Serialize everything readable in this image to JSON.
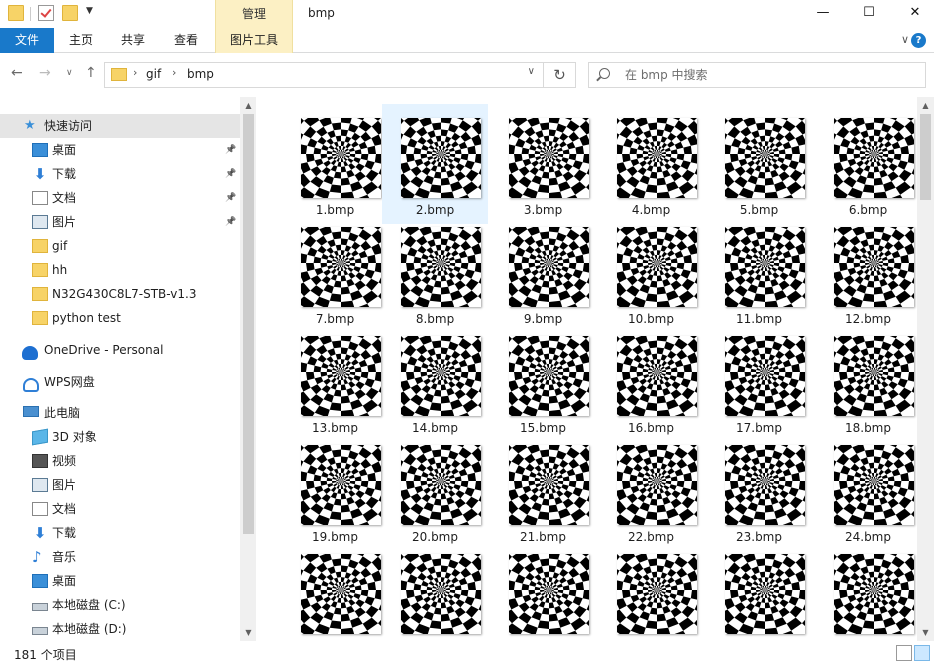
{
  "window": {
    "title": "bmp",
    "contextual_tab_group": "管理",
    "minimize_glyph": "—",
    "maximize_glyph": "☐",
    "close_glyph": "✕"
  },
  "ribbon": {
    "tabs": [
      "文件",
      "主页",
      "共享",
      "查看",
      "图片工具"
    ],
    "collapse_glyph": "∨",
    "help_glyph": "?"
  },
  "address": {
    "breadcrumb": [
      "gif",
      "bmp"
    ],
    "search_placeholder": "在 bmp 中搜索"
  },
  "sidebar": {
    "quick_access": "快速访问",
    "quick_items": [
      {
        "label": "桌面",
        "icon": "desktop-icon",
        "pinned": true
      },
      {
        "label": "下载",
        "icon": "download-icon",
        "pinned": true
      },
      {
        "label": "文档",
        "icon": "document-icon",
        "pinned": true
      },
      {
        "label": "图片",
        "icon": "pictures-icon",
        "pinned": true
      },
      {
        "label": "gif",
        "icon": "folder-icon",
        "pinned": false
      },
      {
        "label": "hh",
        "icon": "folder-icon",
        "pinned": false
      },
      {
        "label": "N32G430C8L7-STB-v1.3",
        "icon": "folder-icon",
        "pinned": false
      },
      {
        "label": "python test",
        "icon": "folder-icon",
        "pinned": false
      }
    ],
    "onedrive": "OneDrive - Personal",
    "wps": "WPS网盘",
    "this_pc": "此电脑",
    "pc_items": [
      {
        "label": "3D 对象",
        "icon": "3d-objects-icon"
      },
      {
        "label": "视频",
        "icon": "videos-icon"
      },
      {
        "label": "图片",
        "icon": "pictures-icon"
      },
      {
        "label": "文档",
        "icon": "document-icon"
      },
      {
        "label": "下载",
        "icon": "download-icon"
      },
      {
        "label": "音乐",
        "icon": "music-icon"
      },
      {
        "label": "桌面",
        "icon": "desktop-icon"
      },
      {
        "label": "本地磁盘 (C:)",
        "icon": "drive-c-icon"
      },
      {
        "label": "本地磁盘 (D:)",
        "icon": "drive-d-icon"
      }
    ]
  },
  "files": [
    "1.bmp",
    "2.bmp",
    "3.bmp",
    "4.bmp",
    "5.bmp",
    "6.bmp",
    "7.bmp",
    "8.bmp",
    "9.bmp",
    "10.bmp",
    "11.bmp",
    "12.bmp",
    "13.bmp",
    "14.bmp",
    "15.bmp",
    "16.bmp",
    "17.bmp",
    "18.bmp",
    "19.bmp",
    "20.bmp",
    "21.bmp",
    "22.bmp",
    "23.bmp",
    "24.bmp",
    "",
    "",
    "",
    "",
    "",
    ""
  ],
  "selected_file": "2.bmp",
  "status": {
    "item_count": "181 个项目"
  },
  "colors": {
    "accent": "#1979ca",
    "context_tab": "#fcf0c4",
    "selection": "#e5f3ff"
  }
}
